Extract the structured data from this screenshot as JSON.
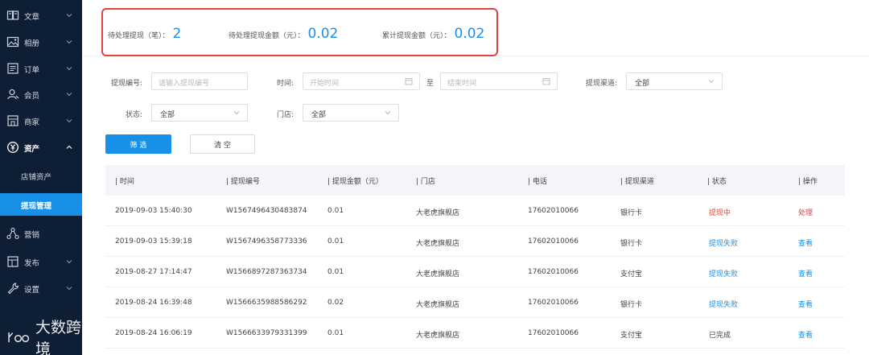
{
  "sidebar": {
    "items": [
      {
        "label": "文章",
        "icon": "book-icon"
      },
      {
        "label": "相册",
        "icon": "image-icon"
      },
      {
        "label": "订单",
        "icon": "order-list-icon"
      },
      {
        "label": "会员",
        "icon": "user-icon"
      },
      {
        "label": "商家",
        "icon": "store-icon"
      },
      {
        "label": "资产",
        "icon": "yen-circle-icon",
        "expanded": true
      },
      {
        "label": "营销",
        "icon": "share-nodes-icon"
      },
      {
        "label": "发布",
        "icon": "publish-icon"
      },
      {
        "label": "设置",
        "icon": "wrench-icon"
      }
    ],
    "sub_items": [
      {
        "label": "店铺资产",
        "active": false
      },
      {
        "label": "提现管理",
        "active": true
      }
    ]
  },
  "watermark": {
    "text": "大数跨境"
  },
  "stats": {
    "pending_count": {
      "label": "待处理提现（笔）：",
      "value": "2"
    },
    "pending_amount": {
      "label": "待处理提现金额（元）：",
      "value": "0.02"
    },
    "total_amount": {
      "label": "累计提现金额（元）：",
      "value": "0.02"
    }
  },
  "filters": {
    "withdraw_no": {
      "label": "提现编号:",
      "placeholder": "请输入提现编号"
    },
    "time": {
      "label": "时间:",
      "start_placeholder": "开始时间",
      "to": "至",
      "end_placeholder": "结束时间"
    },
    "channel": {
      "label": "提现渠道:",
      "value": "全部"
    },
    "status": {
      "label": "状态:",
      "value": "全部"
    },
    "store": {
      "label": "门店:",
      "value": "全部"
    }
  },
  "buttons": {
    "filter": "筛 选",
    "clear": "清 空"
  },
  "colors": {
    "accent": "#1890e8",
    "danger": "#e0463b",
    "sidebar_bg": "#0e1e35"
  },
  "table": {
    "headers": [
      "| 时间",
      "| 提现编号",
      "| 提现金额（元）",
      "| 门店",
      "| 电话",
      "| 提现渠道",
      "| 状态",
      "| 操作"
    ],
    "rows": [
      {
        "time": "2019-09-03 15:40:30",
        "no": "W1567496430483874",
        "amount": "0.01",
        "store": "大老虎旗舰店",
        "phone": "17602010066",
        "channel": "银行卡",
        "status": "提现中",
        "status_tone": "red",
        "action": "处理",
        "action_tone": "red"
      },
      {
        "time": "2019-09-03 15:39:18",
        "no": "W1567496358773336",
        "amount": "0.01",
        "store": "大老虎旗舰店",
        "phone": "17602010066",
        "channel": "银行卡",
        "status": "提现失败",
        "status_tone": "blue",
        "action": "查看",
        "action_tone": "blue"
      },
      {
        "time": "2019-08-27 17:14:47",
        "no": "W1566897287363734",
        "amount": "0.01",
        "store": "大老虎旗舰店",
        "phone": "17602010066",
        "channel": "支付宝",
        "status": "提现失败",
        "status_tone": "blue",
        "action": "查看",
        "action_tone": "blue"
      },
      {
        "time": "2019-08-24 16:39:48",
        "no": "W1566635988586292",
        "amount": "0.02",
        "store": "大老虎旗舰店",
        "phone": "17602010066",
        "channel": "银行卡",
        "status": "提现失败",
        "status_tone": "blue",
        "action": "查看",
        "action_tone": "blue"
      },
      {
        "time": "2019-08-24 16:06:19",
        "no": "W1566633979331399",
        "amount": "0.01",
        "store": "大老虎旗舰店",
        "phone": "17602010066",
        "channel": "支付宝",
        "status": "已完成",
        "status_tone": "plain",
        "action": "查看",
        "action_tone": "blue"
      }
    ]
  }
}
